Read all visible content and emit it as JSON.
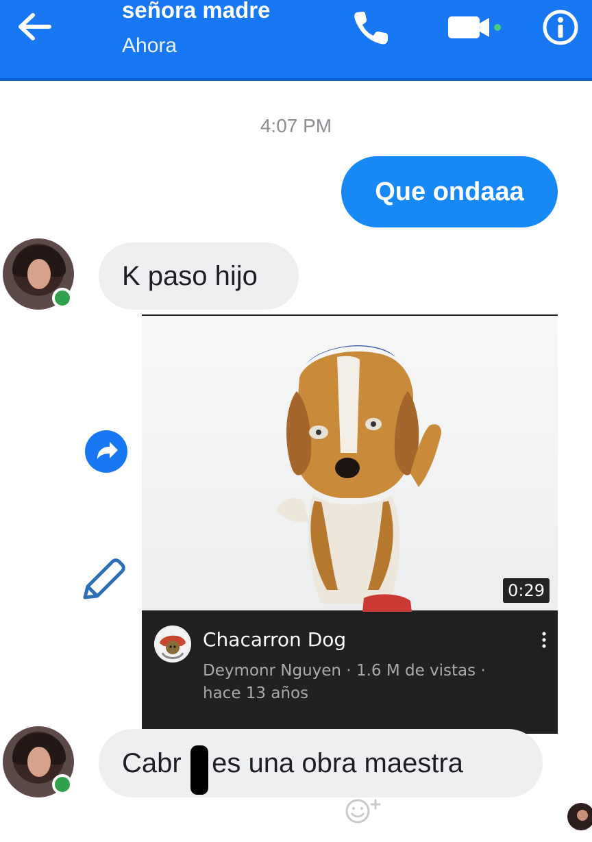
{
  "header": {
    "contact_name": "señora madre",
    "status": "Ahora",
    "icons": {
      "back": "arrow-left-icon",
      "call": "phone-icon",
      "video": "video-camera-icon",
      "info": "info-icon"
    }
  },
  "thread": {
    "timestamp": "4:07 PM",
    "messages": [
      {
        "sender": "me",
        "text": "Que ondaaa"
      },
      {
        "sender": "contact",
        "text": "K paso hijo"
      },
      {
        "sender": "contact",
        "text": "Cabr n es una obra maestra"
      }
    ],
    "shared_video": {
      "duration": "0:29",
      "title": "Chacarron Dog",
      "meta": "Deymonr Nguyen · 1.6 M de vistas · hace 13 años"
    }
  },
  "colors": {
    "header": "#1877f2",
    "outgoing_bubble": "#1689f7",
    "incoming_bubble": "#eeeff1",
    "online": "#31a24c",
    "video_card": "#212121"
  }
}
